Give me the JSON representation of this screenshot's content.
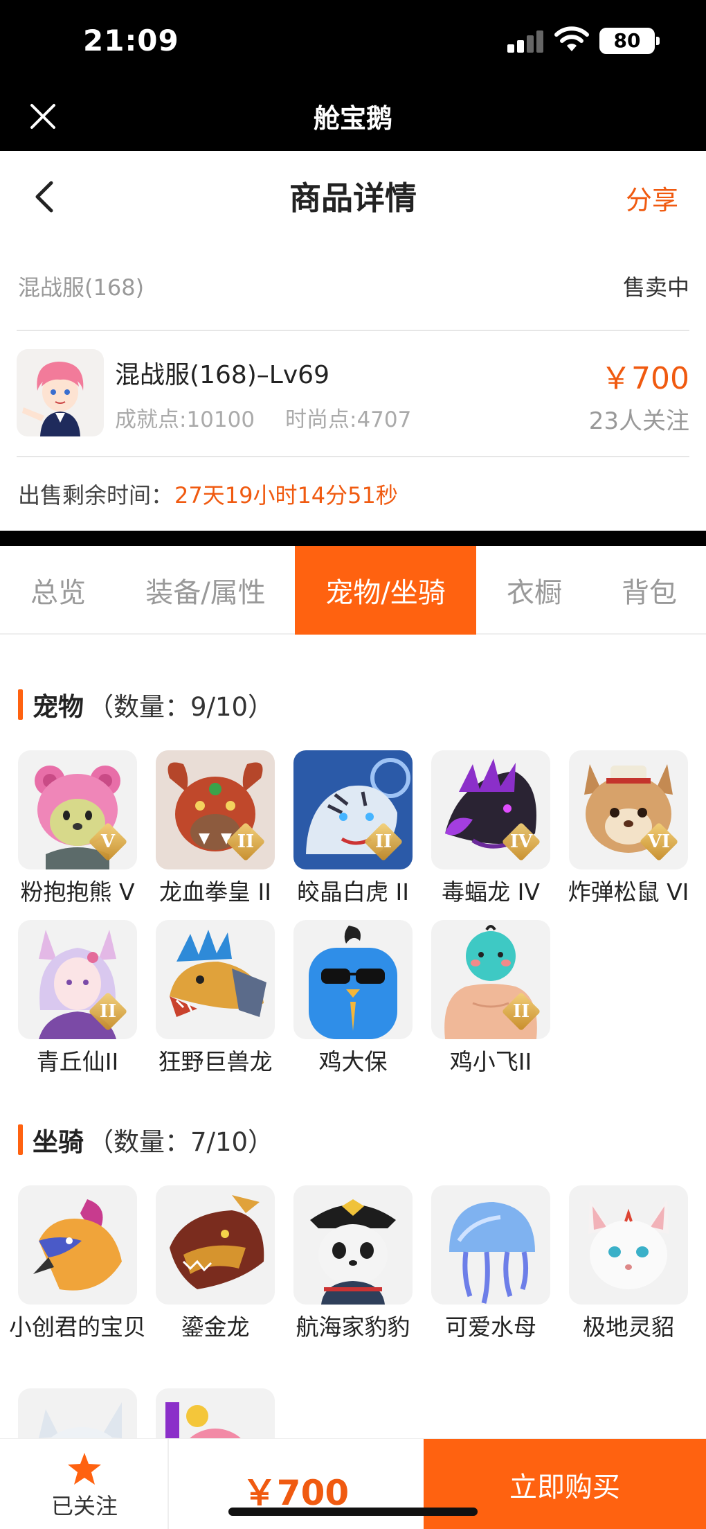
{
  "status_bar": {
    "time": "21:09",
    "battery": "80"
  },
  "app_bar": {
    "title": "舱宝鹅"
  },
  "header": {
    "title": "商品详情",
    "share": "分享"
  },
  "product": {
    "server": "混战服(168)",
    "status": "售卖中",
    "name": "混战服(168)–Lv69",
    "achievement": "成就点:10100",
    "fashion": "时尚点:4707",
    "price": "￥700",
    "followers": "23人关注",
    "remaining_label": "出售剩余时间：",
    "remaining_value": "27天19小时14分51秒"
  },
  "tabs": [
    {
      "label": "总览",
      "active": false
    },
    {
      "label": "装备/属性",
      "active": false
    },
    {
      "label": "宠物/坐骑",
      "active": true
    },
    {
      "label": "衣橱",
      "active": false
    },
    {
      "label": "背包",
      "active": false
    }
  ],
  "pets": {
    "title": "宠物",
    "count": "（数量：9/10）",
    "items": [
      {
        "name": "粉抱抱熊 V",
        "rank": "V",
        "icon": "pink-bear"
      },
      {
        "name": "龙血拳皇 II",
        "rank": "II",
        "icon": "red-dragon"
      },
      {
        "name": "皎晶白虎 II",
        "rank": "II",
        "icon": "white-tiger"
      },
      {
        "name": "毒蝠龙 IV",
        "rank": "IV",
        "icon": "purple-dragon"
      },
      {
        "name": "炸弹松鼠 VI",
        "rank": "VI",
        "icon": "squirrel"
      },
      {
        "name": "青丘仙II",
        "rank": "II",
        "icon": "fox-fairy"
      },
      {
        "name": "狂野巨兽龙",
        "rank": "",
        "icon": "beast-dragon"
      },
      {
        "name": "鸡大保",
        "rank": "",
        "icon": "blue-bird"
      },
      {
        "name": "鸡小飞II",
        "rank": "II",
        "icon": "chick"
      }
    ]
  },
  "mounts": {
    "title": "坐骑",
    "count": "（数量：7/10）",
    "items": [
      {
        "name": "小创君的宝贝",
        "icon": "phoenix"
      },
      {
        "name": "鎏金龙",
        "icon": "gold-dragon"
      },
      {
        "name": "航海家豹豹",
        "icon": "pirate-panda"
      },
      {
        "name": "可爱水母",
        "icon": "jellyfish"
      },
      {
        "name": "极地灵貂",
        "icon": "polar-ferret"
      },
      {
        "name": "",
        "icon": "white-wolf"
      },
      {
        "name": "",
        "icon": "pink-pet"
      }
    ]
  },
  "bottom": {
    "follow": "已关注",
    "price": "￥700",
    "buy": "立即购买"
  },
  "colors": {
    "accent": "#ff6210",
    "price": "#f05a10"
  }
}
